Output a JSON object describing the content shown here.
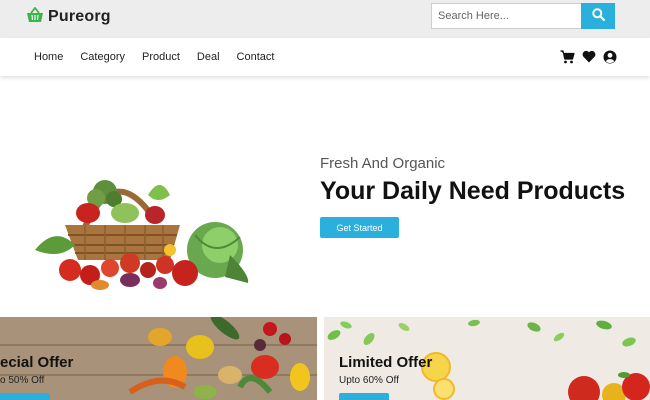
{
  "brand": {
    "name": "Pureorg",
    "accent": "#2bb0dd",
    "logo_icon": "basket-icon",
    "logo_color": "#3bb54a"
  },
  "search": {
    "placeholder": "Search Here...",
    "icon": "search-icon"
  },
  "nav": {
    "links": [
      "Home",
      "Category",
      "Product",
      "Deal",
      "Contact"
    ],
    "icons": [
      "cart-icon",
      "heart-icon",
      "user-icon"
    ]
  },
  "hero": {
    "subtitle": "Fresh And Organic",
    "title": "Your Daily Need Products",
    "cta": "Get Started"
  },
  "banners": [
    {
      "title": "ecial Offer",
      "subtitle": "o 50% Off"
    },
    {
      "title": "Limited Offer",
      "subtitle": "Upto 60% Off"
    }
  ]
}
